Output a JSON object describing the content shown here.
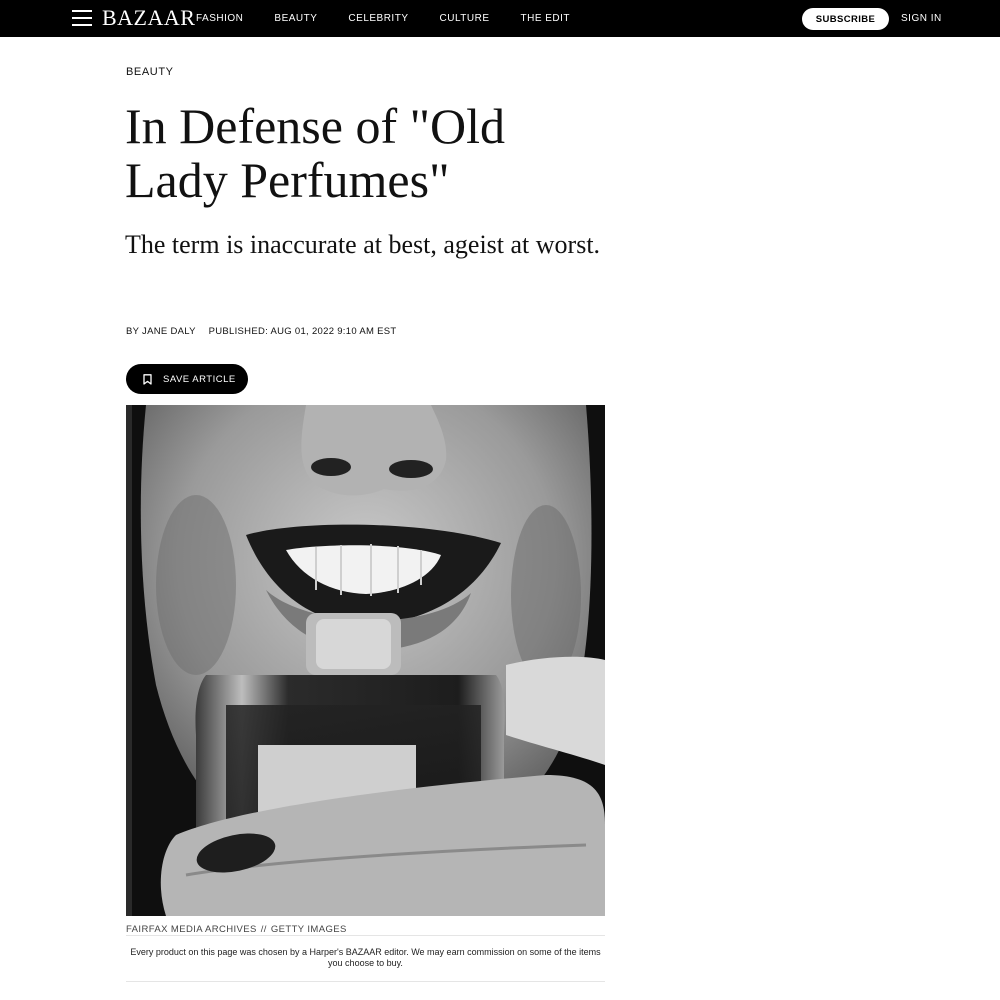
{
  "nav": {
    "logo": "BAZAAR",
    "links": [
      "FASHION",
      "BEAUTY",
      "CELEBRITY",
      "CULTURE",
      "THE EDIT"
    ],
    "subscribe_label": "SUBSCRIBE",
    "signin_label": "SIGN IN",
    "background": "#000000"
  },
  "article": {
    "section": "BEAUTY",
    "headline": "In Defense of \"Old Lady Perfumes\"",
    "dek": "The term is inaccurate at best, ageist at worst.",
    "byline": {
      "author": "BY JANE DALY",
      "published": "PUBLISHED: AUG 01, 2022 9:10 AM EST"
    },
    "save_label": "SAVE ARTICLE",
    "save_icon": "bookmark-icon",
    "hero_image": {
      "description_icon": "perfume-photo",
      "credit_source": "FAIRFAX MEDIA ARCHIVES",
      "credit_separator": "//",
      "credit_agency": "GETTY IMAGES"
    },
    "disclaimer": "Every product on this page was chosen by a Harper's BAZAAR editor. We may earn commission on some of the items you choose to buy."
  },
  "icons": [
    "menu-icon",
    "bookmark-icon"
  ],
  "colors": {
    "accent": "#000000",
    "background": "#ffffff"
  }
}
